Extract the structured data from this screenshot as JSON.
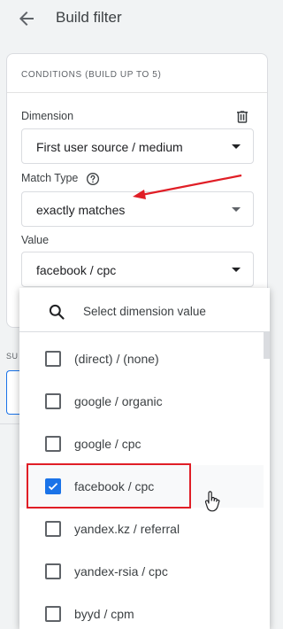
{
  "header": {
    "title": "Build filter",
    "back_icon": "arrow-left-icon"
  },
  "conditions": {
    "section_label": "CONDITIONS (BUILD UP TO 5)",
    "dimension": {
      "label": "Dimension",
      "value": "First user source / medium",
      "delete_icon": "trash-icon"
    },
    "match_type": {
      "label": "Match Type",
      "value": "exactly matches",
      "help_icon": "help-circle-icon"
    },
    "value_field": {
      "label": "Value",
      "value": "facebook / cpc"
    }
  },
  "background": {
    "truncated_label": "SU"
  },
  "dropdown": {
    "search_placeholder": "Select dimension value",
    "options": [
      {
        "label": "(direct) / (none)",
        "checked": false
      },
      {
        "label": "google / organic",
        "checked": false
      },
      {
        "label": "google / cpc",
        "checked": false
      },
      {
        "label": "facebook / cpc",
        "checked": true
      },
      {
        "label": "yandex.kz / referral",
        "checked": false
      },
      {
        "label": "yandex-rsia / cpc",
        "checked": false
      },
      {
        "label": "byyd / cpm",
        "checked": false
      }
    ]
  },
  "colors": {
    "accent": "#1a73e8",
    "highlight": "#e01e26",
    "background": "#f1f3f4"
  }
}
